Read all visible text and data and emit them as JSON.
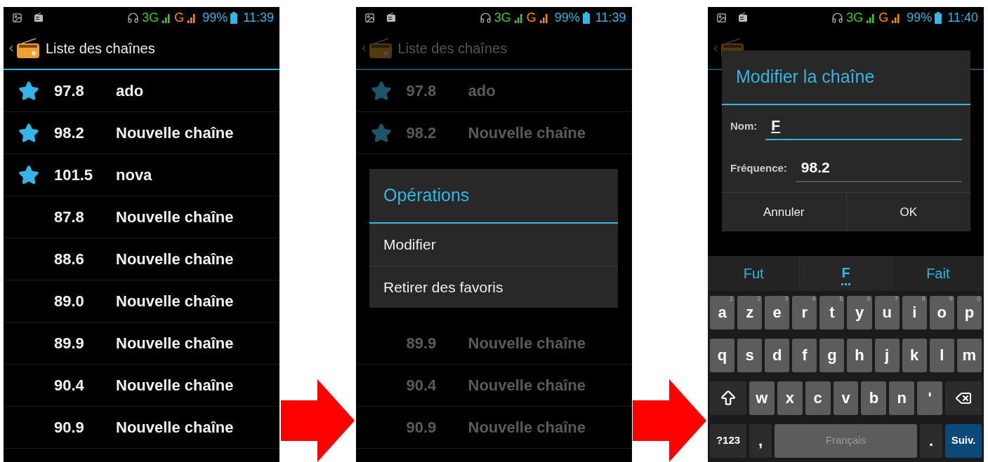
{
  "screens": [
    {
      "kind": "list",
      "dimmed": false,
      "status_bar": {
        "network_1": "3G",
        "network_2": "G",
        "battery": "99%",
        "time": "11:39"
      },
      "app_bar": {
        "title": "Liste des chaînes"
      },
      "channels": [
        {
          "frequency": "97.8",
          "name": "ado",
          "favorite": true
        },
        {
          "frequency": "98.2",
          "name": "Nouvelle chaîne",
          "favorite": true
        },
        {
          "frequency": "101.5",
          "name": "nova",
          "favorite": true
        },
        {
          "frequency": "87.8",
          "name": "Nouvelle chaîne",
          "favorite": false
        },
        {
          "frequency": "88.6",
          "name": "Nouvelle chaîne",
          "favorite": false
        },
        {
          "frequency": "89.0",
          "name": "Nouvelle chaîne",
          "favorite": false
        },
        {
          "frequency": "89.9",
          "name": "Nouvelle chaîne",
          "favorite": false
        },
        {
          "frequency": "90.4",
          "name": "Nouvelle chaîne",
          "favorite": false
        },
        {
          "frequency": "90.9",
          "name": "Nouvelle chaîne",
          "favorite": false
        }
      ]
    },
    {
      "kind": "menu",
      "dimmed": true,
      "status_bar": {
        "network_1": "3G",
        "network_2": "G",
        "battery": "99%",
        "time": "11:39"
      },
      "app_bar": {
        "title": "Liste des chaînes"
      },
      "channels_above": [
        {
          "frequency": "97.8",
          "name": "ado",
          "favorite": true
        },
        {
          "frequency": "98.2",
          "name": "Nouvelle chaîne",
          "favorite": true
        }
      ],
      "menu": {
        "title": "Opérations",
        "items": [
          "Modifier",
          "Retirer des favoris"
        ]
      },
      "channels_below": [
        {
          "frequency": "89.9",
          "name": "Nouvelle chaîne",
          "favorite": false
        },
        {
          "frequency": "90.4",
          "name": "Nouvelle chaîne",
          "favorite": false
        },
        {
          "frequency": "90.9",
          "name": "Nouvelle chaîne",
          "favorite": false
        }
      ]
    },
    {
      "kind": "edit",
      "dimmed": true,
      "status_bar": {
        "network_1": "3G",
        "network_2": "G",
        "battery": "99%",
        "time": "11:40"
      },
      "dialog": {
        "title": "Modifier la chaîne",
        "fields": [
          {
            "label": "Nom:",
            "value": "F",
            "focused": true
          },
          {
            "label": "Fréquence:",
            "value": "98.2",
            "focused": false
          }
        ],
        "buttons": [
          "Annuler",
          "OK"
        ]
      },
      "keyboard": {
        "suggestions": [
          {
            "text": "Fut",
            "selected": false
          },
          {
            "text": "F",
            "selected": true
          },
          {
            "text": "Fait",
            "selected": false
          }
        ],
        "rows": [
          {
            "keys": [
              {
                "kind": "letter",
                "label": "a",
                "hint": "1"
              },
              {
                "kind": "letter",
                "label": "z",
                "hint": "2"
              },
              {
                "kind": "letter",
                "label": "e",
                "hint": "3"
              },
              {
                "kind": "letter",
                "label": "r",
                "hint": "4"
              },
              {
                "kind": "letter",
                "label": "t",
                "hint": "5"
              },
              {
                "kind": "letter",
                "label": "y",
                "hint": "6"
              },
              {
                "kind": "letter",
                "label": "u",
                "hint": "7"
              },
              {
                "kind": "letter",
                "label": "i",
                "hint": "8"
              },
              {
                "kind": "letter",
                "label": "o",
                "hint": "9"
              },
              {
                "kind": "letter",
                "label": "p",
                "hint": "0"
              }
            ]
          },
          {
            "keys": [
              {
                "kind": "letter",
                "label": "q"
              },
              {
                "kind": "letter",
                "label": "s"
              },
              {
                "kind": "letter",
                "label": "d"
              },
              {
                "kind": "letter",
                "label": "f"
              },
              {
                "kind": "letter",
                "label": "g"
              },
              {
                "kind": "letter",
                "label": "h"
              },
              {
                "kind": "letter",
                "label": "j"
              },
              {
                "kind": "letter",
                "label": "k"
              },
              {
                "kind": "letter",
                "label": "l"
              },
              {
                "kind": "letter",
                "label": "m"
              }
            ]
          },
          {
            "keys": [
              {
                "kind": "shift"
              },
              {
                "kind": "letter",
                "label": "w"
              },
              {
                "kind": "letter",
                "label": "x"
              },
              {
                "kind": "letter",
                "label": "c"
              },
              {
                "kind": "letter",
                "label": "v"
              },
              {
                "kind": "letter",
                "label": "b"
              },
              {
                "kind": "letter",
                "label": "n"
              },
              {
                "kind": "letter",
                "label": "'"
              },
              {
                "kind": "backspace"
              }
            ]
          },
          {
            "keys": [
              {
                "kind": "symbols",
                "label": "?123"
              },
              {
                "kind": "punct",
                "label": ","
              },
              {
                "kind": "space",
                "label": "Français"
              },
              {
                "kind": "punct",
                "label": "."
              },
              {
                "kind": "action",
                "label": "Suiv."
              }
            ]
          }
        ]
      }
    }
  ]
}
